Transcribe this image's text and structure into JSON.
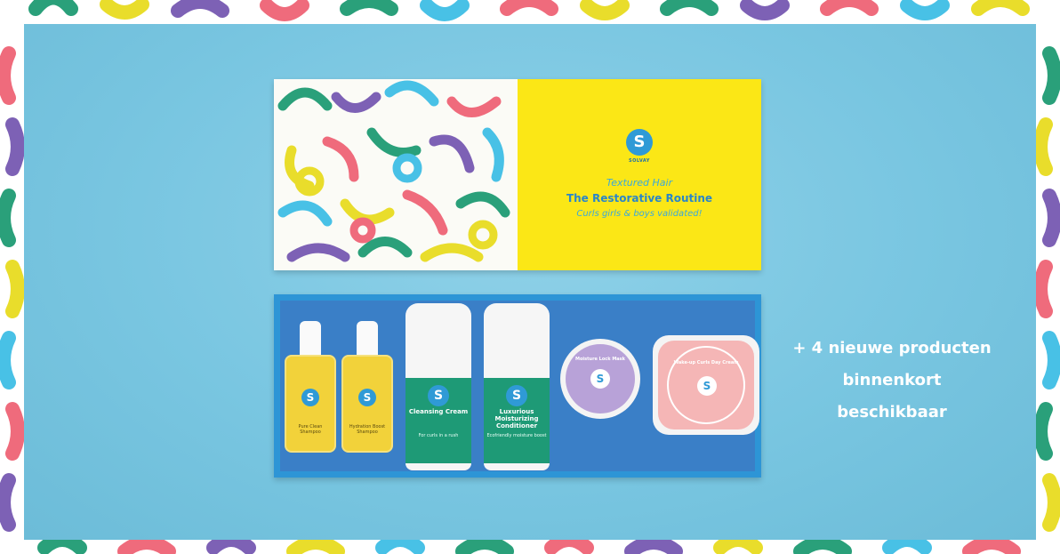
{
  "product": {
    "brand": "SOLVAY",
    "lid_subtitle": "Textured Hair",
    "lid_title": "The Restorative Routine",
    "lid_tagline": "Curls girls & boys validated!"
  },
  "items": [
    {
      "name": "Pure Clean Shampoo",
      "detail": ""
    },
    {
      "name": "Hydration Boost Shampoo",
      "detail": ""
    },
    {
      "name": "Cleansing Cream",
      "detail": "For curls in a rush"
    },
    {
      "name": "Luxurious Moisturizing Conditioner",
      "detail": "Ecofriendly moisture boost"
    },
    {
      "name": "Moisture Lock Mask",
      "detail": ""
    },
    {
      "name": "Wake-up Curls Day Cream",
      "detail": ""
    }
  ],
  "promo": {
    "line1": "+ 4 nieuwe producten",
    "line2": "binnenkort",
    "line3": "beschikbaar"
  },
  "colors": {
    "background": "#79c6e1",
    "label_yellow": "#fbe716",
    "tray_blue": "#2d95d6",
    "tube_green": "#1e9a76",
    "jar_purple": "#b8a2d8",
    "jar_pink": "#f5b6b6"
  }
}
